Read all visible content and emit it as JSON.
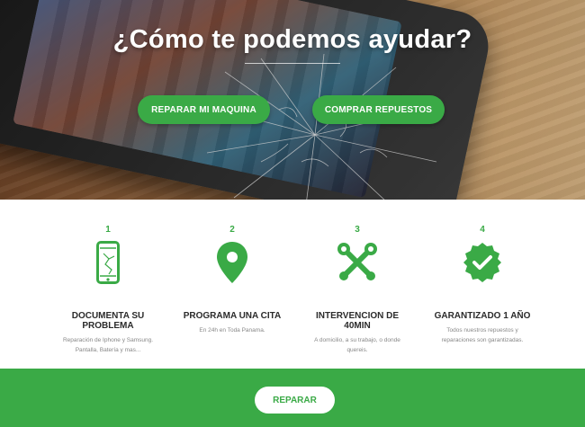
{
  "hero": {
    "title": "¿Cómo te podemos ayudar?",
    "buttons": {
      "repair": "REPARAR MI MAQUINA",
      "parts": "COMPRAR REPUESTOS"
    }
  },
  "steps": [
    {
      "number": "1",
      "icon": "cracked-phone-icon",
      "title_line1": "DOCUMENTA SU",
      "title_line2": "PROBLEMA",
      "desc_line1": "Reparación de Iphone y Samsung.",
      "desc_line2": "Pantalla, Batería y mas..."
    },
    {
      "number": "2",
      "icon": "map-pin-icon",
      "title_line1": "PROGRAMA UNA CITA",
      "title_line2": "",
      "desc_line1": "En 24h en Toda Panama.",
      "desc_line2": ""
    },
    {
      "number": "3",
      "icon": "tools-icon",
      "title_line1": "INTERVENCION DE",
      "title_line2": "40MIN",
      "desc_line1": "A domicilio, a su trabajo, o donde",
      "desc_line2": "quereis."
    },
    {
      "number": "4",
      "icon": "check-badge-icon",
      "title_line1": "GARANTIZADO 1 AÑO",
      "title_line2": "",
      "desc_line1": "Todos nuestros repuestos y",
      "desc_line2": "reparaciones son garantizadas."
    }
  ],
  "footer": {
    "button": "REPARAR"
  },
  "colors": {
    "accent": "#3aaa46",
    "title_text": "#2b2b2b",
    "desc_text": "#888888"
  }
}
